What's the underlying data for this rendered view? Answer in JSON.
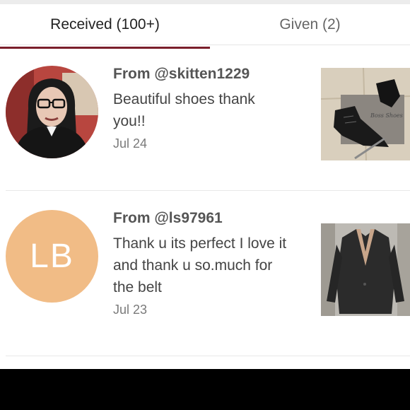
{
  "tabs": {
    "received": "Received (100+)",
    "given": "Given (2)"
  },
  "colors": {
    "accent": "#7a1f2b",
    "avatar_initials_bg": "#f1bc86"
  },
  "feedback": [
    {
      "from": "From @skitten1229",
      "message": "Beautiful shoes thank you!!",
      "date": "Jul 24",
      "avatar": "photo",
      "item_image": "boots-photo"
    },
    {
      "from": "From @ls97961",
      "message": "Thank u its perfect I love it and thank u so.much for the belt",
      "date": "Jul 23",
      "avatar": "initials",
      "avatar_initials": "LB",
      "item_image": "blazer-photo"
    }
  ]
}
